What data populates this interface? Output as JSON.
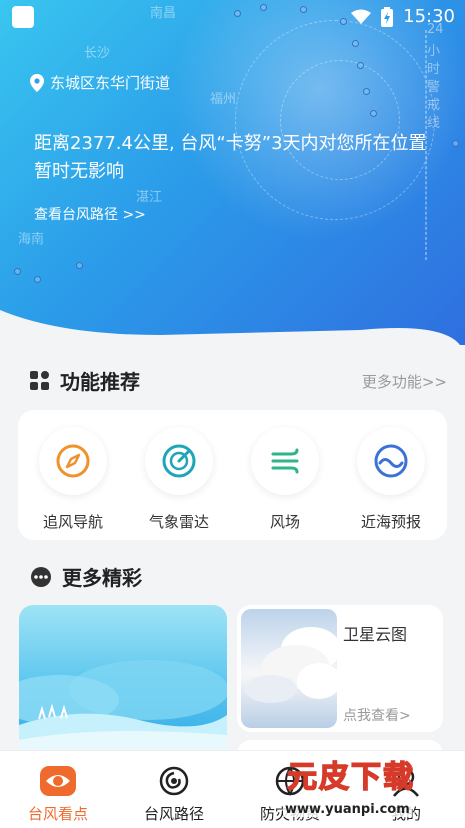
{
  "status_bar": {
    "time": "15:30"
  },
  "hero": {
    "location": "东城区东华门街道",
    "typhoon_message": "距离2377.4公里, 台风“卡努”3天内对您所在位置暂时无影响",
    "route_link": "查看台风路径 >>",
    "map_labels": [
      "南昌",
      "长沙",
      "福州",
      "海南",
      "湛江",
      "24",
      "小",
      "时",
      "警",
      "戒",
      "线"
    ]
  },
  "features": {
    "title": "功能推荐",
    "more": "更多功能>>",
    "items": [
      {
        "label": "追风导航",
        "icon": "compass-icon",
        "color": "#f0922c"
      },
      {
        "label": "气象雷达",
        "icon": "radar-icon",
        "color": "#1ea6b8"
      },
      {
        "label": "风场",
        "icon": "wind-icon",
        "color": "#2fb58a"
      },
      {
        "label": "近海预报",
        "icon": "wave-icon",
        "color": "#3c72d6"
      }
    ]
  },
  "more_section": {
    "title": "更多精彩",
    "satellite_card": {
      "title": "卫星云图",
      "link": "点我查看>"
    }
  },
  "tabbar": {
    "tabs": [
      {
        "label": "台风看点",
        "active": true
      },
      {
        "label": "台风路径",
        "active": false
      },
      {
        "label": "防灾物资",
        "active": false
      },
      {
        "label": "我的",
        "active": false
      }
    ]
  },
  "watermark": {
    "logo": "元皮下载",
    "url": "www.yuanpi.com"
  },
  "colors": {
    "accent": "#ef6a2d",
    "hero_start": "#39c6ef",
    "hero_end": "#2f6fe0"
  }
}
